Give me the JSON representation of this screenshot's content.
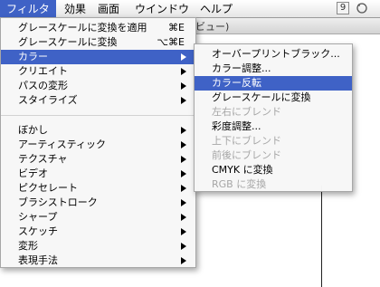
{
  "menubar": {
    "items": [
      {
        "label": "フィルタ",
        "active": true
      },
      {
        "label": "効果"
      },
      {
        "label": "画面"
      },
      {
        "label": "ウインドウ"
      },
      {
        "label": "ヘルプ"
      }
    ],
    "right_icon": "9"
  },
  "background_window": {
    "title_fragment": "ビュー)"
  },
  "filter_menu": {
    "items": [
      {
        "label": "グレースケールに変換を適用",
        "shortcut": "⌘E"
      },
      {
        "label": "グレースケールに変換",
        "shortcut": "⌥⌘E"
      },
      {
        "label": "カラー",
        "submenu": true,
        "highlighted": true
      },
      {
        "label": "クリエイト",
        "submenu": true
      },
      {
        "label": "パスの変形",
        "submenu": true
      },
      {
        "label": "スタイライズ",
        "submenu": true
      },
      {
        "label": "ぼかし",
        "submenu": true
      },
      {
        "label": "アーティスティック",
        "submenu": true
      },
      {
        "label": "テクスチャ",
        "submenu": true
      },
      {
        "label": "ビデオ",
        "submenu": true
      },
      {
        "label": "ピクセレート",
        "submenu": true
      },
      {
        "label": "ブラシストローク",
        "submenu": true
      },
      {
        "label": "シャープ",
        "submenu": true
      },
      {
        "label": "スケッチ",
        "submenu": true
      },
      {
        "label": "変形",
        "submenu": true
      },
      {
        "label": "表現手法",
        "submenu": true
      }
    ]
  },
  "color_submenu": {
    "items": [
      {
        "label": "オーバープリントブラック..."
      },
      {
        "label": "カラー調整..."
      },
      {
        "label": "カラー反転",
        "highlighted": true
      },
      {
        "label": "グレースケールに変換"
      },
      {
        "label": "左右にブレンド",
        "disabled": true
      },
      {
        "label": "彩度調整..."
      },
      {
        "label": "上下にブレンド",
        "disabled": true
      },
      {
        "label": "前後にブレンド",
        "disabled": true
      },
      {
        "label": "CMYK に変換"
      },
      {
        "label": "RGB に変換",
        "disabled": true
      }
    ]
  }
}
